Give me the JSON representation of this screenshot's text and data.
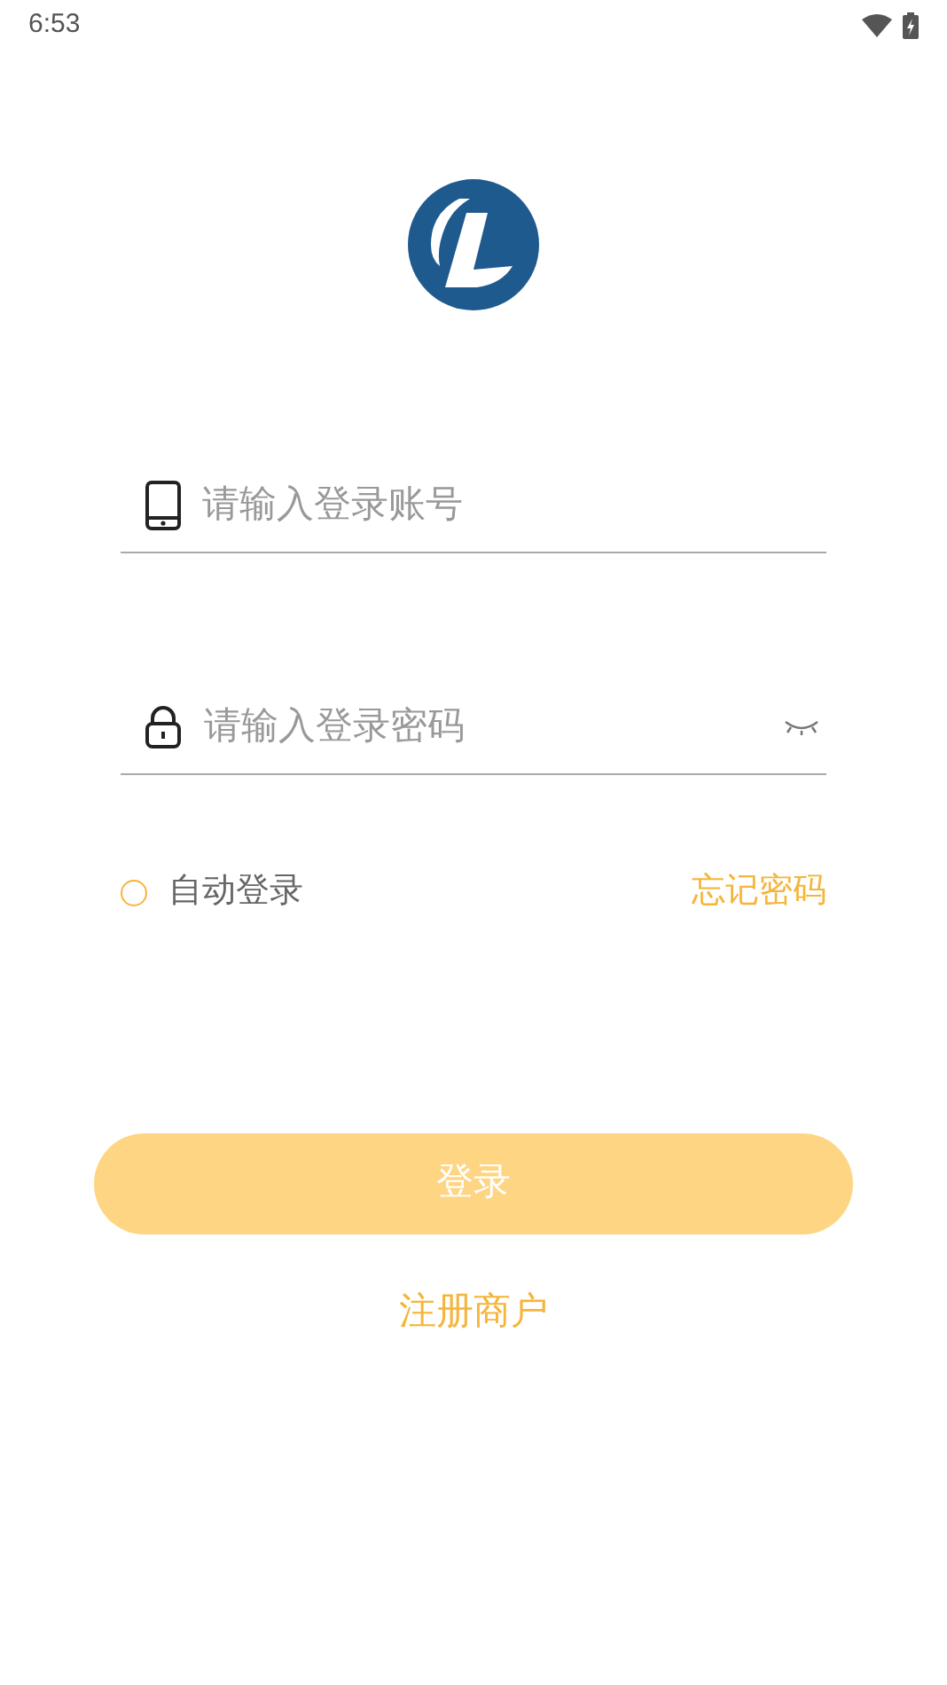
{
  "status_bar": {
    "time": "6:53"
  },
  "account_field": {
    "placeholder": "请输入登录账号"
  },
  "password_field": {
    "placeholder": "请输入登录密码"
  },
  "auto_login": {
    "label": "自动登录",
    "checked": false
  },
  "forgot_password": "忘记密码",
  "login_button": "登录",
  "register_link": "注册商户"
}
